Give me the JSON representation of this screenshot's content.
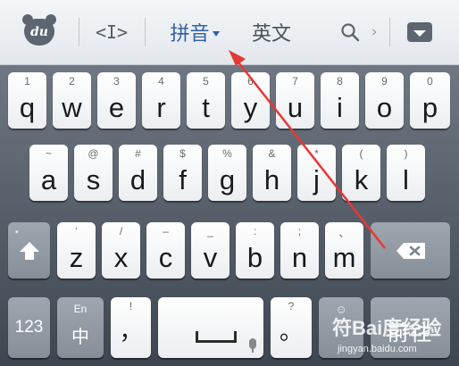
{
  "toolbar": {
    "logo_text": "du",
    "cursor_symbol": "<I>",
    "pinyin_label": "拼音",
    "english_label": "英文",
    "more_symbol": "›",
    "icons": [
      "bear-logo-icon",
      "cursor-icon",
      "search-icon",
      "collapse-keyboard-icon"
    ]
  },
  "keyboard": {
    "row1": [
      {
        "hint": "1",
        "key": "q"
      },
      {
        "hint": "2",
        "key": "w"
      },
      {
        "hint": "3",
        "key": "e"
      },
      {
        "hint": "4",
        "key": "r"
      },
      {
        "hint": "5",
        "key": "t"
      },
      {
        "hint": "6",
        "key": "y"
      },
      {
        "hint": "7",
        "key": "u"
      },
      {
        "hint": "8",
        "key": "i"
      },
      {
        "hint": "9",
        "key": "o"
      },
      {
        "hint": "0",
        "key": "p"
      }
    ],
    "row2": [
      {
        "hint": "~",
        "key": "a"
      },
      {
        "hint": "@",
        "key": "s"
      },
      {
        "hint": "#",
        "key": "d"
      },
      {
        "hint": "$",
        "key": "f"
      },
      {
        "hint": "%",
        "key": "g"
      },
      {
        "hint": "&",
        "key": "h"
      },
      {
        "hint": "*",
        "key": "j"
      },
      {
        "hint": "(",
        "key": "k"
      },
      {
        "hint": ")",
        "key": "l"
      }
    ],
    "row3": [
      {
        "hint": "‘",
        "key": "z"
      },
      {
        "hint": "/",
        "key": "x"
      },
      {
        "hint": "–",
        "key": "c"
      },
      {
        "hint": "_",
        "key": "v"
      },
      {
        "hint": ":",
        "key": "b"
      },
      {
        "hint": ";",
        "key": "n"
      },
      {
        "hint": "、",
        "key": "m"
      }
    ],
    "shift_dot": "•",
    "row4": {
      "num_label": "123",
      "lang_top": "En",
      "lang_main": "中",
      "comma_hint": "!",
      "comma_key": "，",
      "period_hint": "?",
      "period_key": "。",
      "emoji_hint": "☺",
      "enter_label": "前往"
    }
  },
  "watermark": {
    "brand": "符Bai度经验",
    "url": "jingyan.baidu.com"
  },
  "colors": {
    "accent_pinyin": "#2f5fa8",
    "arrow_red": "#e53935"
  }
}
